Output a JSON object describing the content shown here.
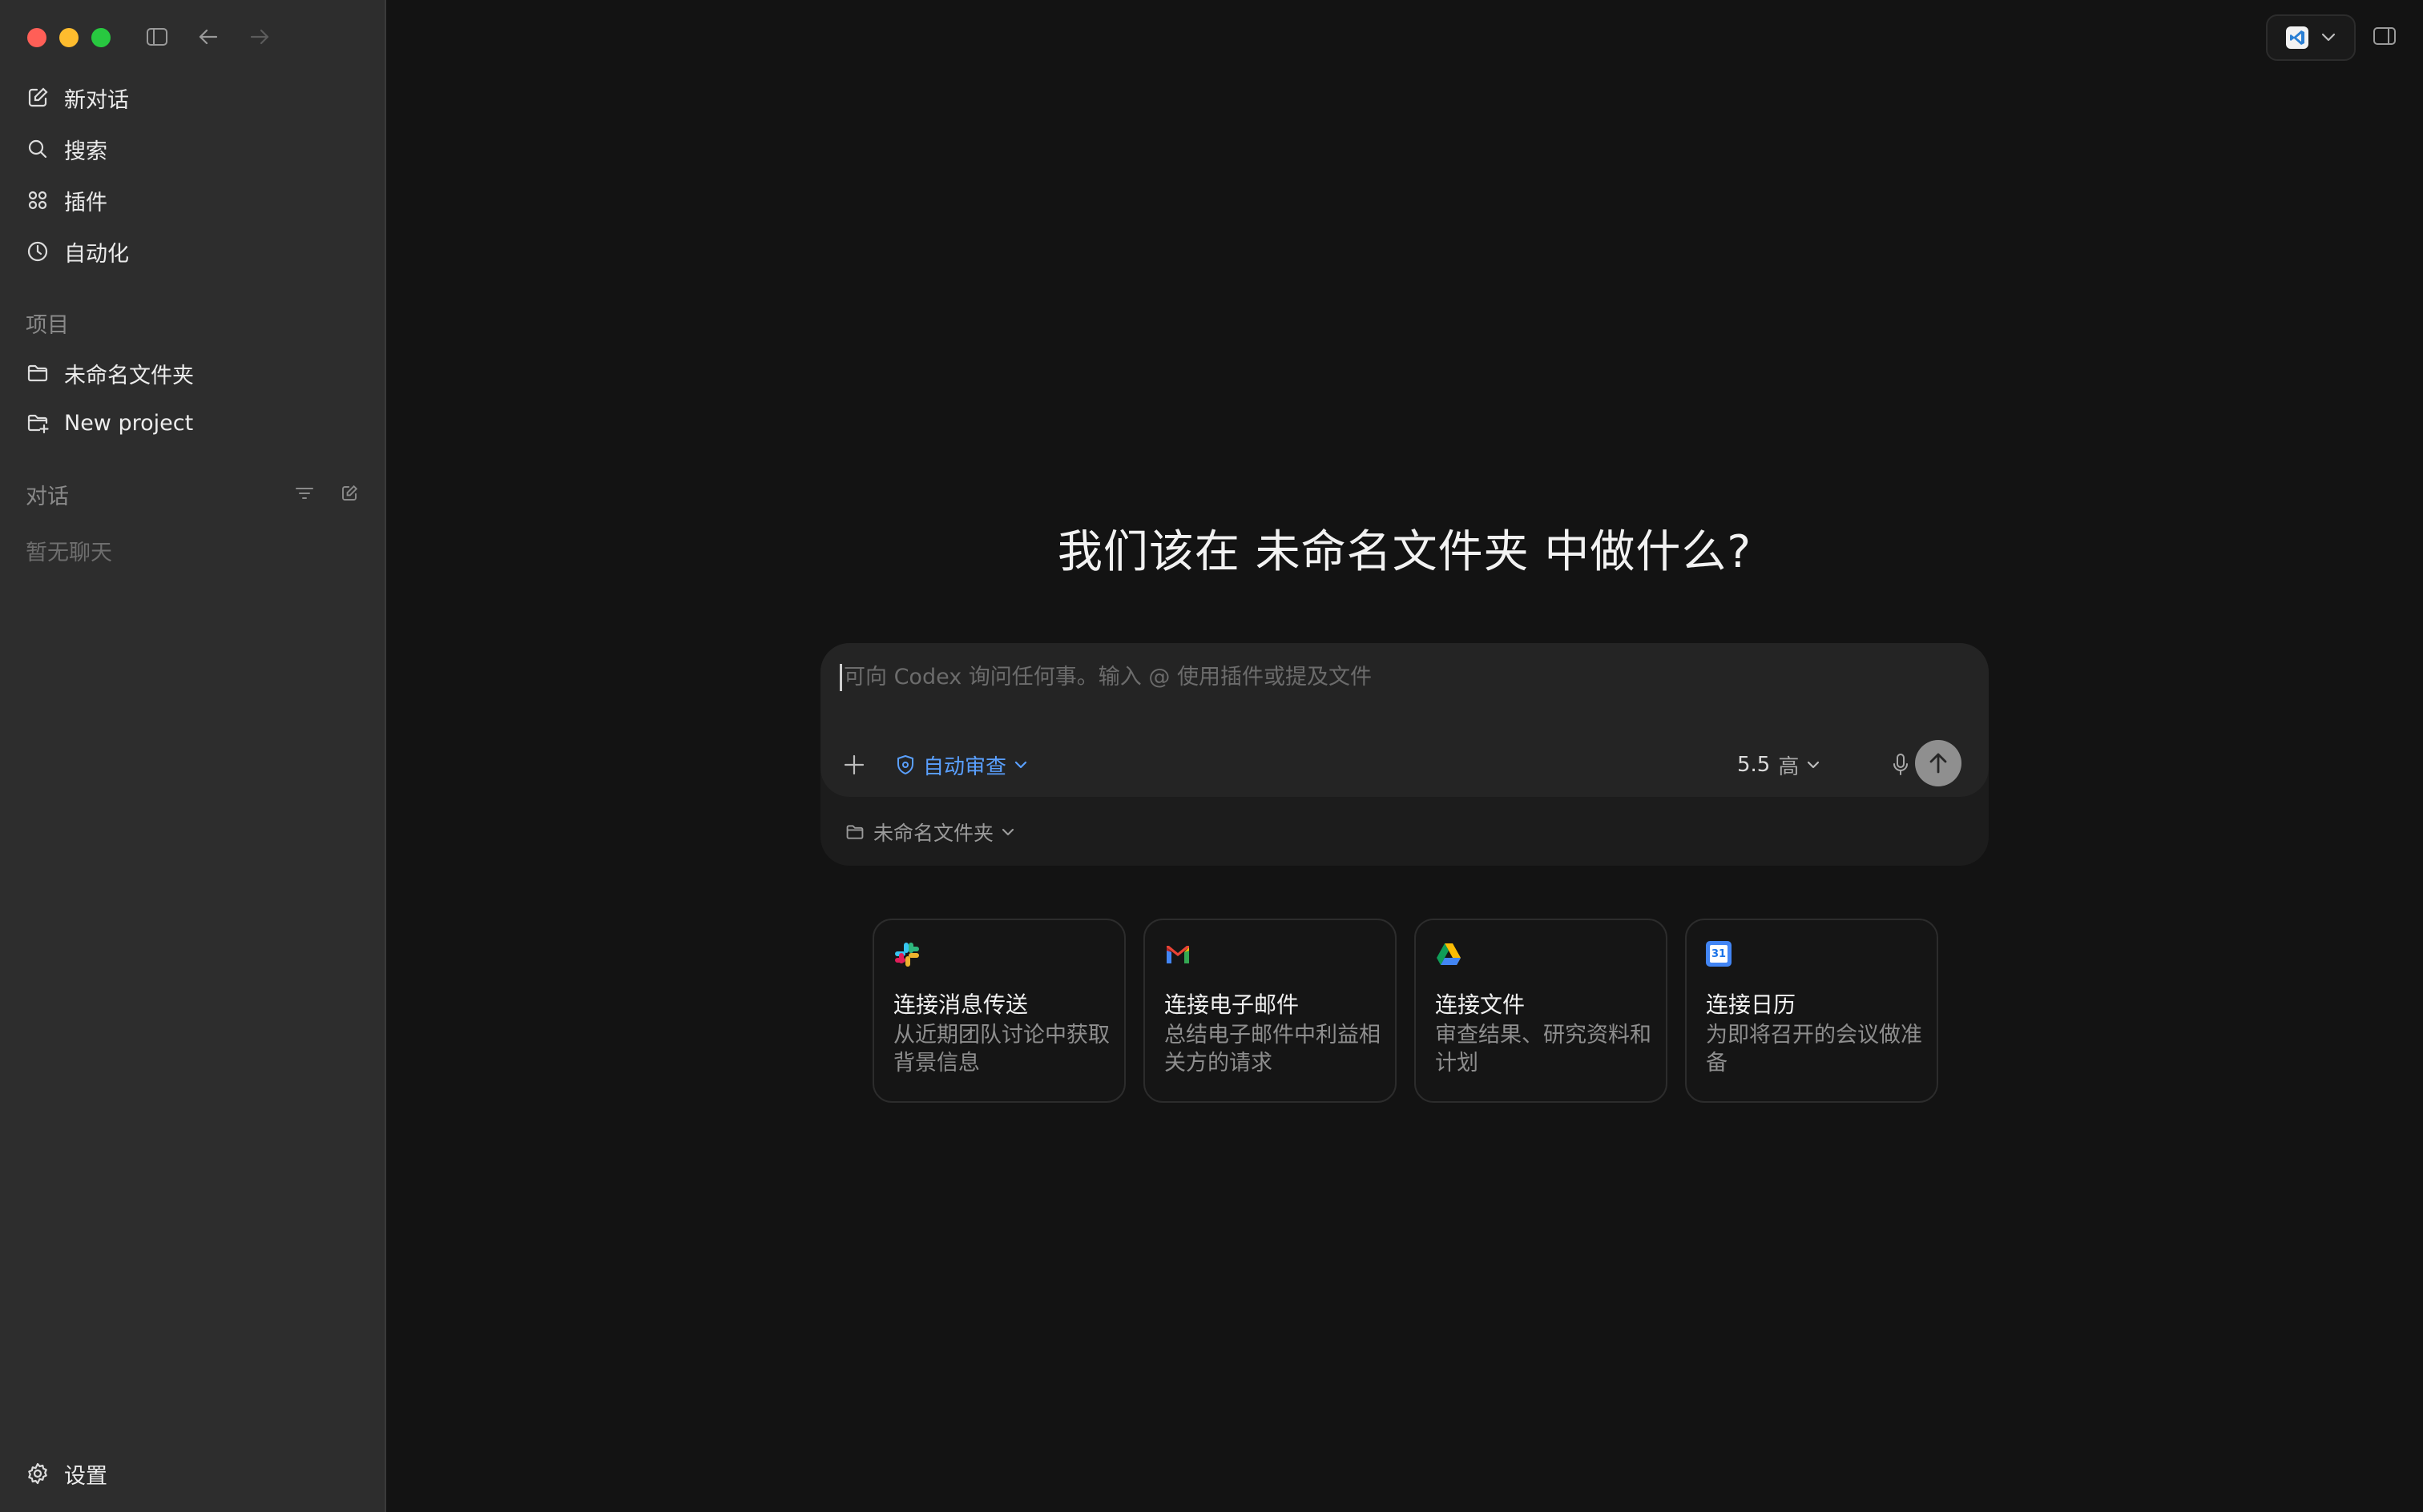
{
  "sidebar": {
    "nav": [
      {
        "label": "新对话",
        "icon": "new-chat-icon"
      },
      {
        "label": "搜索",
        "icon": "search-icon"
      },
      {
        "label": "插件",
        "icon": "plugins-icon"
      },
      {
        "label": "自动化",
        "icon": "clock-icon"
      }
    ],
    "projects_label": "项目",
    "projects": [
      {
        "label": "未命名文件夹",
        "icon": "folder-icon"
      },
      {
        "label": "New project",
        "icon": "folder-plus-icon"
      }
    ],
    "chats_label": "对话",
    "chats_empty": "暂无聊天",
    "settings_label": "设置"
  },
  "main": {
    "heading": "我们该在 未命名文件夹 中做什么?",
    "composer": {
      "placeholder": "可向 Codex 询问任何事。输入 @ 使用插件或提及文件",
      "approval_label": "自动审查",
      "model_version": "5.5",
      "effort": "高",
      "folder_label": "未命名文件夹"
    },
    "cards": [
      {
        "title": "连接消息传送",
        "desc": "从近期团队讨论中获取背景信息",
        "icon": "slack-icon"
      },
      {
        "title": "连接电子邮件",
        "desc": "总结电子邮件中利益相关方的请求",
        "icon": "gmail-icon"
      },
      {
        "title": "连接文件",
        "desc": "审查结果、研究资料和计划",
        "icon": "google-drive-icon"
      },
      {
        "title": "连接日历",
        "desc": "为即将召开的会议做准备",
        "icon": "google-calendar-icon"
      }
    ],
    "calendar_icon_text": "31"
  },
  "colors": {
    "accent": "#5aa0ff",
    "traffic_red": "#ff5f57",
    "traffic_yellow": "#febc2e",
    "traffic_green": "#28c840"
  }
}
